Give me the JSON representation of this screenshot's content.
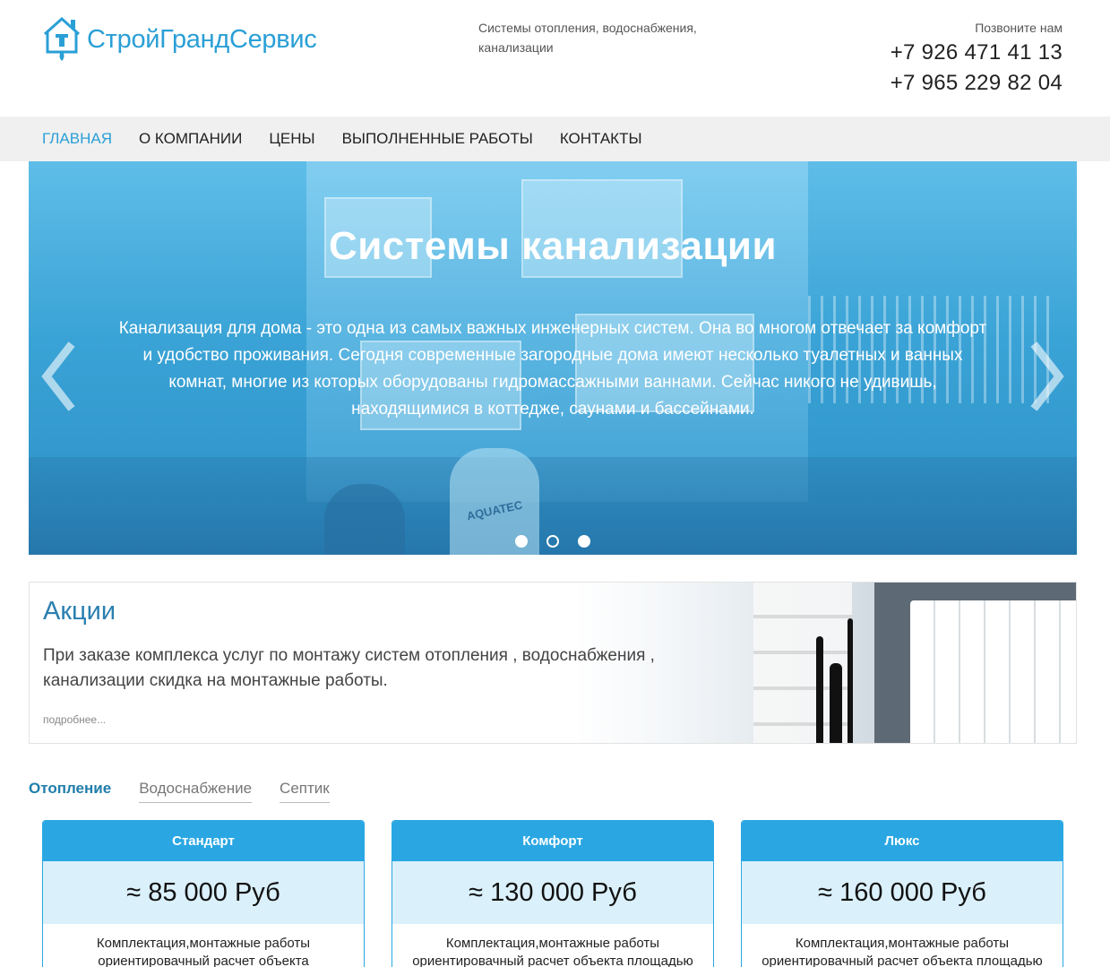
{
  "header": {
    "logo_text": "СтройГрандСервис",
    "tagline": "Системы отопления, водоснабжения, канализации",
    "contact_label": "Позвоните нам",
    "phones": [
      "+7 926 471 41 13",
      "+7 965 229 82 04"
    ]
  },
  "nav": {
    "items": [
      "ГЛАВНАЯ",
      "О КОМПАНИИ",
      "ЦЕНЫ",
      "ВЫПОЛНЕННЫЕ РАБОТЫ",
      "КОНТАКТЫ"
    ],
    "active_index": 0
  },
  "slider": {
    "title": "Системы канализации",
    "text": "Канализация для дома - это одна из самых важных инженерных систем. Она во многом отвечает за комфорт и удобство проживания. Сегодня современные загородные дома имеют несколько туалетных и ванных комнат, многие из которых оборудованы гидромассажными ваннами. Сейчас никого не удивишь, находящимися в коттедже, саунами и бассейнами.",
    "image_label": "AQUATEC",
    "dots": 3,
    "active_dot": 1
  },
  "promo": {
    "title": "Акции",
    "text": "При заказе комплекса услуг по монтажу систем отопления , водоснабжения , канализации скидка на монтажные работы.",
    "more": "подробнее..."
  },
  "tabs": {
    "items": [
      "Отопление",
      "Водоснабжение",
      "Септик"
    ],
    "active_index": 0
  },
  "cards": [
    {
      "name": "Стандарт",
      "price": "≈ 85 000 Руб",
      "desc": "Комплектация,монтажные работы ориентировачный расчет объекта"
    },
    {
      "name": "Комфорт",
      "price": "≈ 130 000 Руб",
      "desc": "Комплектация,монтажные работы ориентировачный расчет объекта площадью"
    },
    {
      "name": "Люкс",
      "price": "≈ 160 000 Руб",
      "desc": "Комплектация,монтажные работы ориентировачный расчет объекта площадью"
    }
  ],
  "colors": {
    "brand": "#2a9fd6",
    "card_head": "#2aa7e3",
    "card_price_bg": "#daf0fb",
    "nav_bg": "#f0f0f0"
  }
}
